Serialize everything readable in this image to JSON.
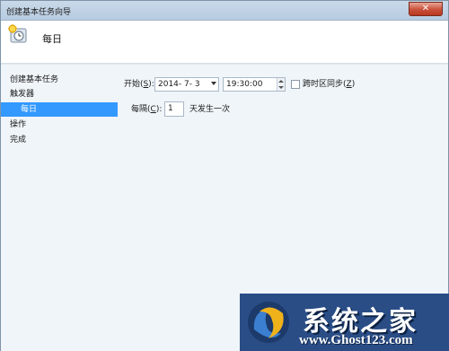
{
  "window": {
    "title": "创建基本任务向导",
    "close_label": "✕"
  },
  "header": {
    "title": "每日",
    "icon": "task-clock-icon"
  },
  "sidebar": {
    "items": [
      {
        "label": "创建基本任务"
      },
      {
        "label": "触发器"
      },
      {
        "label": "每日",
        "active": true
      },
      {
        "label": "操作"
      },
      {
        "label": "完成"
      }
    ]
  },
  "form": {
    "start_label": "开始(",
    "start_accel": "S",
    "start_label_end": "):",
    "date_value": "2014- 7- 3",
    "time_value": "19:30:00",
    "timezone_sync_label": "跨时区同步(",
    "timezone_sync_accel": "Z",
    "timezone_sync_end": ")",
    "timezone_sync_checked": false,
    "recur_label": "每隔(",
    "recur_accel": "C",
    "recur_label_end": "):",
    "recur_value": "1",
    "recur_unit": "天发生一次"
  },
  "watermark": {
    "cn": "系统之家",
    "url": "www.Ghost123.com"
  },
  "colors": {
    "selected": "#3399ff",
    "watermark_bg": "#2a4d86"
  }
}
